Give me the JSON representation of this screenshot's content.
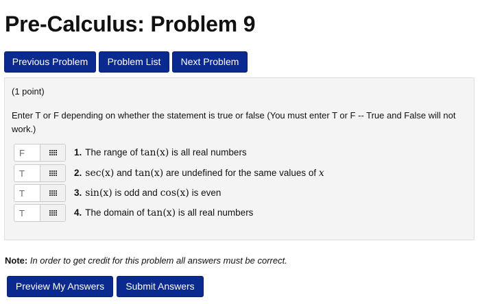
{
  "page": {
    "title": "Pre-Calculus: Problem 9"
  },
  "nav": {
    "previous_label": "Previous Problem",
    "list_label": "Problem List",
    "next_label": "Next Problem"
  },
  "problem": {
    "points": "(1 point)",
    "instructions": "Enter T or F depending on whether the statement is true or false (You must enter T or F -- True and False will not work.)",
    "questions": [
      {
        "num": "1.",
        "answer": "F",
        "pre": "The range of ",
        "math": "tan(x)",
        "post": " is all real numbers"
      },
      {
        "num": "2.",
        "answer": "T",
        "pre": "",
        "math": "sec(x)",
        "mid": " and ",
        "math2": "tan(x)",
        "post": " are undefined for the same values of ",
        "math3": "x"
      },
      {
        "num": "3.",
        "answer": "T",
        "pre": "",
        "math": "sin(x)",
        "mid": " is odd and ",
        "math2": "cos(x)",
        "post": " is even"
      },
      {
        "num": "4.",
        "answer": "T",
        "pre": "The domain of ",
        "math": "tan(x)",
        "post": " is all real numbers"
      }
    ],
    "icon": "grid-icon"
  },
  "note": {
    "label": "Note:",
    "text": "In order to get credit for this problem all answers must be correct."
  },
  "actions": {
    "preview_label": "Preview My Answers",
    "submit_label": "Submit Answers"
  },
  "colors": {
    "button_bg": "#0b2a8f",
    "panel_bg": "#f4f4f4"
  }
}
